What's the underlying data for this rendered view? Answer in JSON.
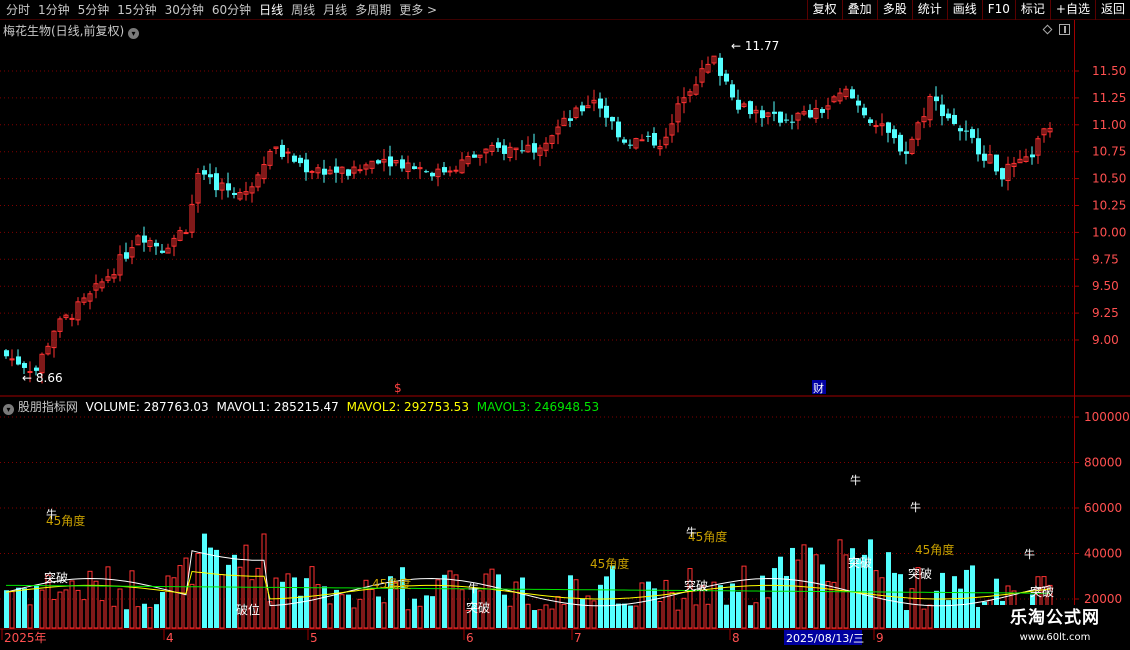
{
  "toolbar": {
    "periods": [
      "分时",
      "1分钟",
      "5分钟",
      "15分钟",
      "30分钟",
      "60分钟",
      "日线",
      "周线",
      "月线",
      "多周期",
      "更多 >"
    ],
    "active_period": "日线",
    "tools": [
      "复权",
      "叠加",
      "多股",
      "统计",
      "画线",
      "F10",
      "标记",
      "+自选",
      "返回"
    ]
  },
  "price_pane": {
    "title": "梅花生物(日线,前复权)",
    "high_label": "11.77",
    "low_label": "8.66",
    "y_ticks": [
      "11.50",
      "11.25",
      "11.00",
      "10.75",
      "10.50",
      "10.25",
      "10.00",
      "9.75",
      "9.50",
      "9.25",
      "9.00"
    ],
    "markers": [
      "$",
      "财"
    ]
  },
  "volume_pane": {
    "title": "股朋指标网",
    "volume_label": "VOLUME: 287763.03",
    "mavol1_label": "MAVOL1: 285215.47",
    "mavol2_label": "MAVOL2: 292753.53",
    "mavol3_label": "MAVOL3: 246948.53",
    "y_ticks": [
      "100000",
      "80000",
      "60000",
      "40000",
      "20000"
    ],
    "annotations": [
      "45角度",
      "突破",
      "牛",
      "破位"
    ]
  },
  "date_axis": {
    "labels": [
      "2025年",
      "4",
      "5",
      "6",
      "7",
      "8",
      "9"
    ],
    "cursor_date": "2025/08/13/三"
  },
  "colors": {
    "up": "#ff3232",
    "down": "#54ffff",
    "ma1": "#ffffff",
    "ma2": "#ffff00",
    "ma3": "#00e600",
    "grid": "#800000"
  },
  "watermark": {
    "title": "乐淘公式网",
    "url": "www.60lt.com"
  }
}
